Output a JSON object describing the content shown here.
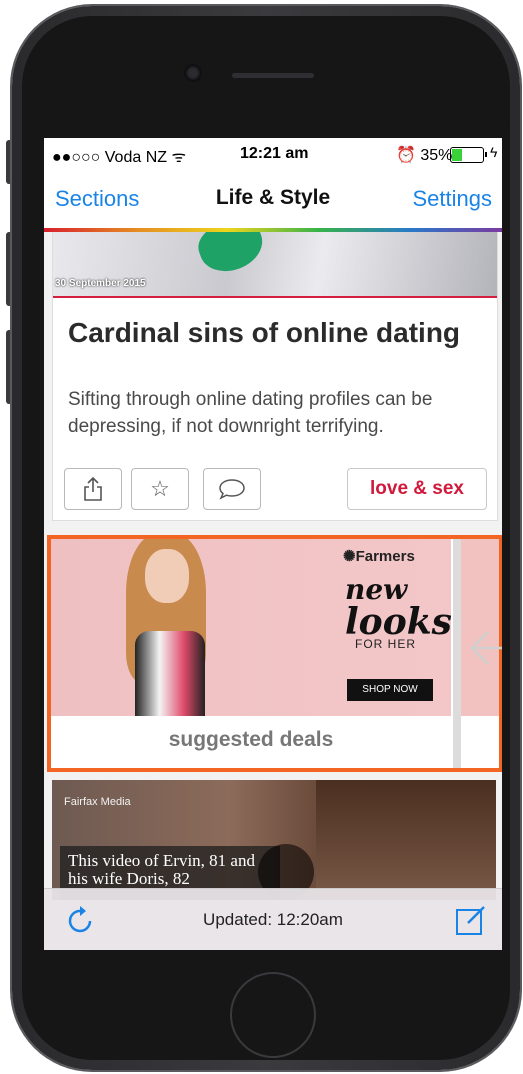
{
  "status_bar": {
    "carrier": "●●○○○ Voda NZ ᯤ",
    "time": "12:21 am",
    "battery_text": "⏰ 35%",
    "battery_level": 0.35
  },
  "nav": {
    "left": "Sections",
    "title": "Life & Style",
    "right": "Settings"
  },
  "article": {
    "date": "30 September 2015",
    "title": "Cardinal sins of online dating",
    "description": "Sifting through online dating profiles can be depressing, if not downright terrifying.",
    "tag": "love & sex",
    "share_icon": "share-icon",
    "star_icon": "star-icon",
    "comment_icon": "comment-icon"
  },
  "ad": {
    "brand": "Farmers",
    "tagline_1": "new",
    "tagline_2": "looks",
    "sub": "FOR HER",
    "cta": "SHOP NOW",
    "label": "suggested deals",
    "highlight_color": "#f26522"
  },
  "video": {
    "logo": "Fairfax Media",
    "caption": "This video of Ervin, 81 and his wife Doris, 82"
  },
  "toolbar": {
    "updated": "Updated: 12:20am",
    "refresh_icon": "refresh-icon",
    "compose_icon": "compose-icon"
  },
  "colors": {
    "ios_blue": "#1a84e6",
    "tag_red": "#d1193c"
  }
}
